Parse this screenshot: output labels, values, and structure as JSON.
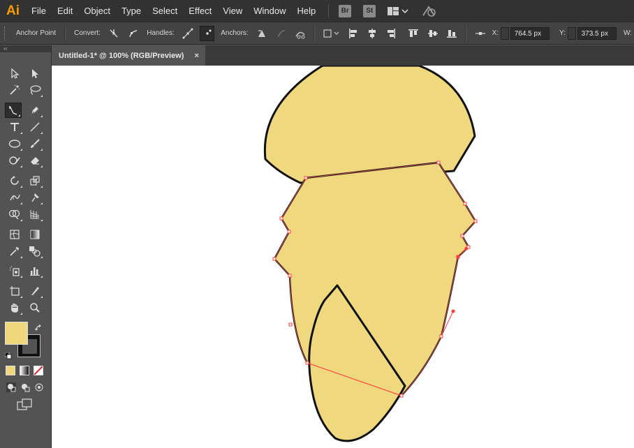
{
  "app": {
    "logo_text": "Ai",
    "brand_color": "#ff9a00"
  },
  "menu": {
    "items": [
      "File",
      "Edit",
      "Object",
      "Type",
      "Select",
      "Effect",
      "View",
      "Window",
      "Help"
    ],
    "bridge_label": "Br",
    "stock_label": "St"
  },
  "control_bar": {
    "tool_name": "Anchor Point",
    "convert_label": "Convert:",
    "handles_label": "Handles:",
    "anchors_label": "Anchors:",
    "x_label": "X:",
    "x_value": "764.5 px",
    "y_label": "Y:",
    "y_value": "373.5 px",
    "w_label": "W:"
  },
  "document": {
    "tab_title": "Untitled-1* @ 100% (RGB/Preview)",
    "close_glyph": "×"
  },
  "toolbox": {
    "collapse_glyph": "‹‹",
    "fill_color": "#efd77c",
    "stroke_color": "#000000",
    "selected_tool": "anchor-point-tool"
  },
  "artwork": {
    "fill_color": "#efd87d",
    "stroke_color": "#111111",
    "selection_color": "#ff5a5a"
  }
}
